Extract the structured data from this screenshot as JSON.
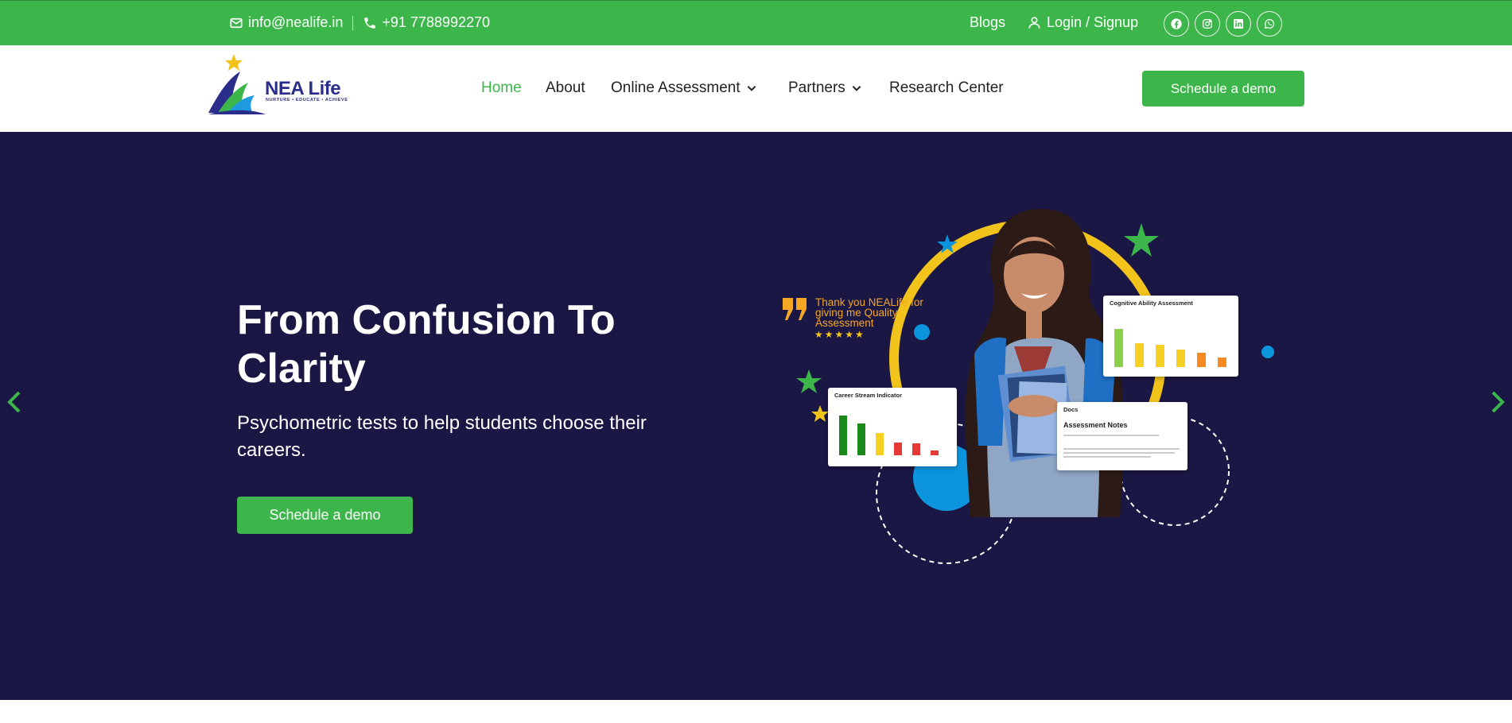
{
  "topbar": {
    "email": "info@nealife.in",
    "phone": "+91 7788992270",
    "blogs_label": "Blogs",
    "login_label": "Login / Signup",
    "social": [
      "facebook-icon",
      "instagram-icon",
      "linkedin-icon",
      "whatsapp-icon"
    ]
  },
  "brand": {
    "name": "NEA Life",
    "tagline": "NURTURE • EDUCATE • ACHIEVE"
  },
  "nav": {
    "items": [
      {
        "label": "Home",
        "active": true
      },
      {
        "label": "About"
      },
      {
        "label": "Online Assessment",
        "dropdown": true
      },
      {
        "label": "Partners",
        "dropdown": true
      },
      {
        "label": "Research Center"
      }
    ],
    "cta": "Schedule a demo"
  },
  "hero": {
    "title": "From Confusion To Clarity",
    "subtitle": "Psychometric tests to help students choose their careers.",
    "cta": "Schedule a demo"
  },
  "illustration": {
    "quote": "Thank you NEALife for giving me Quality Assessment",
    "stars": "★★★★★",
    "card_cognitive": "Cognitive Ability Assessment",
    "card_career": "Career Stream Indicator",
    "card_docs_label": "Docs",
    "card_docs_title": "Assessment Notes"
  },
  "colors": {
    "accent": "#3cb54a",
    "hero_bg": "#1b1745",
    "brand_blue": "#2a2e8a",
    "ring_yellow": "#f2c31b"
  }
}
